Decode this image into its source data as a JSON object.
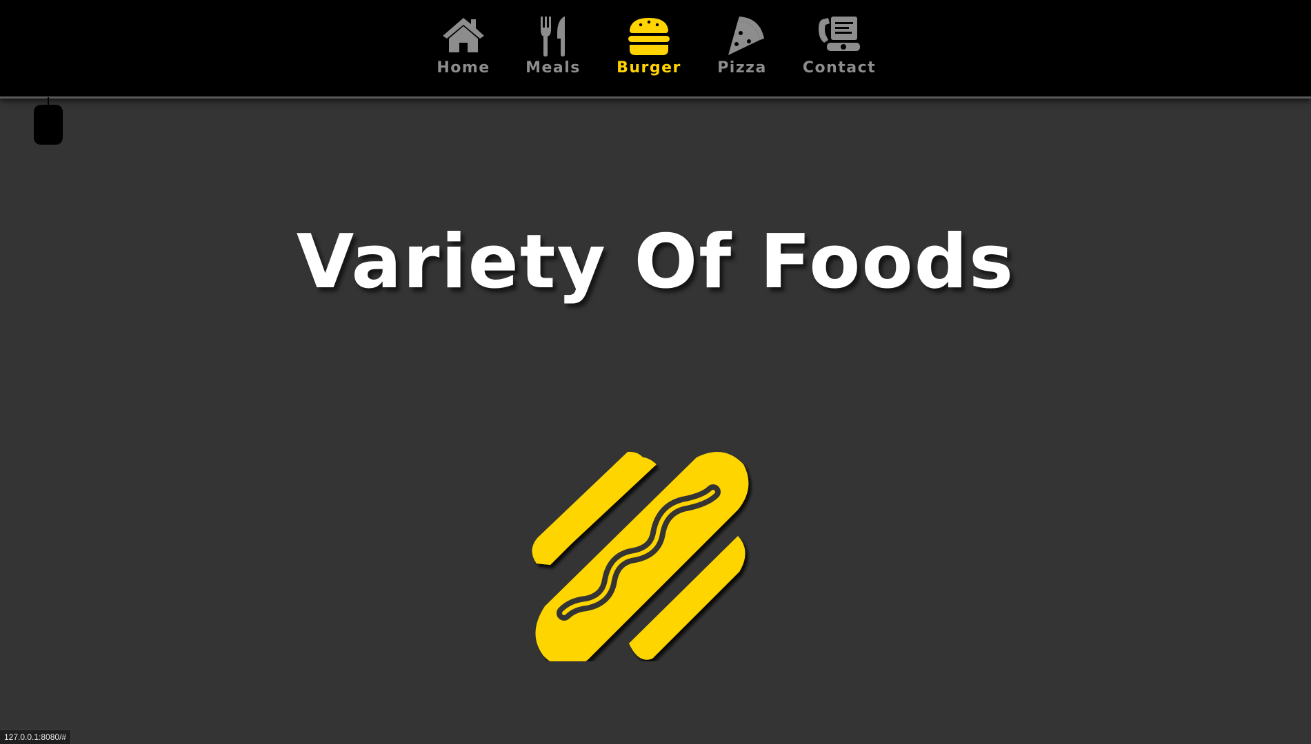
{
  "nav": {
    "items": [
      {
        "label": "Home",
        "icon": "home-icon",
        "active": false
      },
      {
        "label": "Meals",
        "icon": "fork-knife-icon",
        "active": false
      },
      {
        "label": "Burger",
        "icon": "burger-icon",
        "active": true
      },
      {
        "label": "Pizza",
        "icon": "pizza-icon",
        "active": false
      },
      {
        "label": "Contact",
        "icon": "phone-icon",
        "active": false
      }
    ]
  },
  "hero": {
    "title": "Variety Of Foods",
    "logo_icon": "hotdog-icon"
  },
  "status": {
    "url": "127.0.0.1:8080/#"
  },
  "colors": {
    "accent": "#ffd400",
    "nav_background": "#000000",
    "page_background": "#343434",
    "nav_inactive": "#8d8d8d"
  }
}
